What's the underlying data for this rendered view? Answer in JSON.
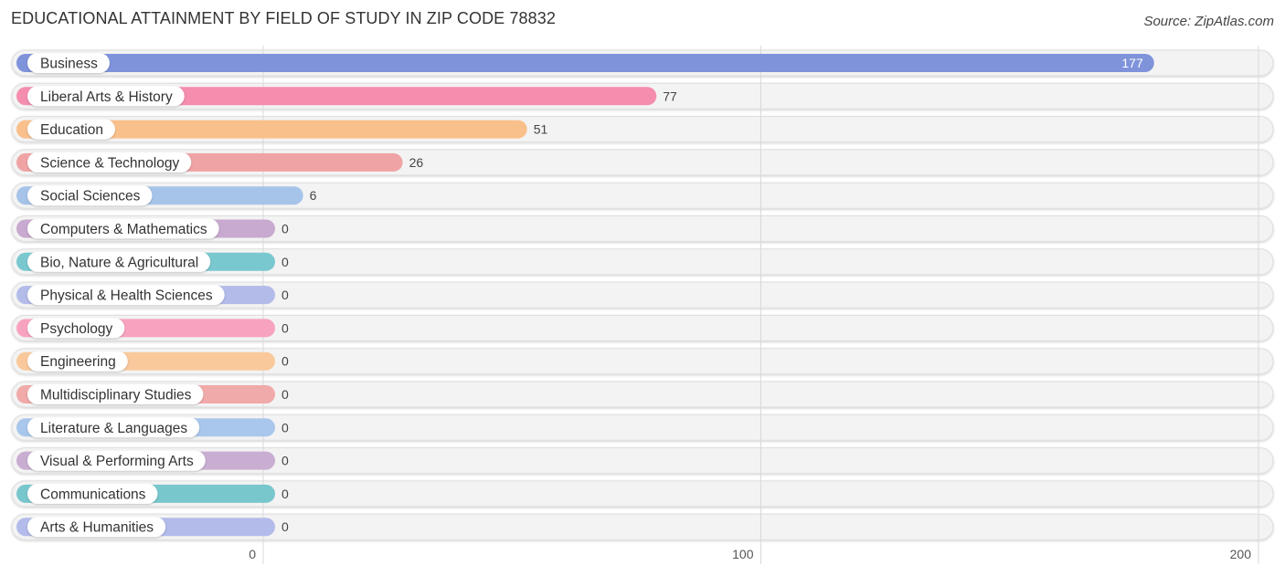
{
  "header": {
    "title": "EDUCATIONAL ATTAINMENT BY FIELD OF STUDY IN ZIP CODE 78832",
    "source": "Source: ZipAtlas.com"
  },
  "chart_data": {
    "type": "bar",
    "orientation": "horizontal",
    "title": "EDUCATIONAL ATTAINMENT BY FIELD OF STUDY IN ZIP CODE 78832",
    "xlabel": "",
    "ylabel": "",
    "xlim": [
      0,
      200
    ],
    "xticks": [
      0,
      100,
      200
    ],
    "grid": true,
    "categories": [
      "Business",
      "Liberal Arts & History",
      "Education",
      "Science & Technology",
      "Social Sciences",
      "Computers & Mathematics",
      "Bio, Nature & Agricultural",
      "Physical & Health Sciences",
      "Psychology",
      "Engineering",
      "Multidisciplinary Studies",
      "Literature & Languages",
      "Visual & Performing Arts",
      "Communications",
      "Arts & Humanities"
    ],
    "values": [
      177,
      77,
      51,
      26,
      6,
      0,
      0,
      0,
      0,
      0,
      0,
      0,
      0,
      0,
      0
    ],
    "colors": [
      "#7f93db",
      "#f48dae",
      "#f9c08c",
      "#efa3a4",
      "#a6c4ea",
      "#c8a9cf",
      "#79c8cf",
      "#b3bbe9",
      "#f7a3c0",
      "#f9c99c",
      "#f0aaa9",
      "#a9c7ec",
      "#c9aed2",
      "#78c7cd",
      "#b3bbea"
    ]
  }
}
